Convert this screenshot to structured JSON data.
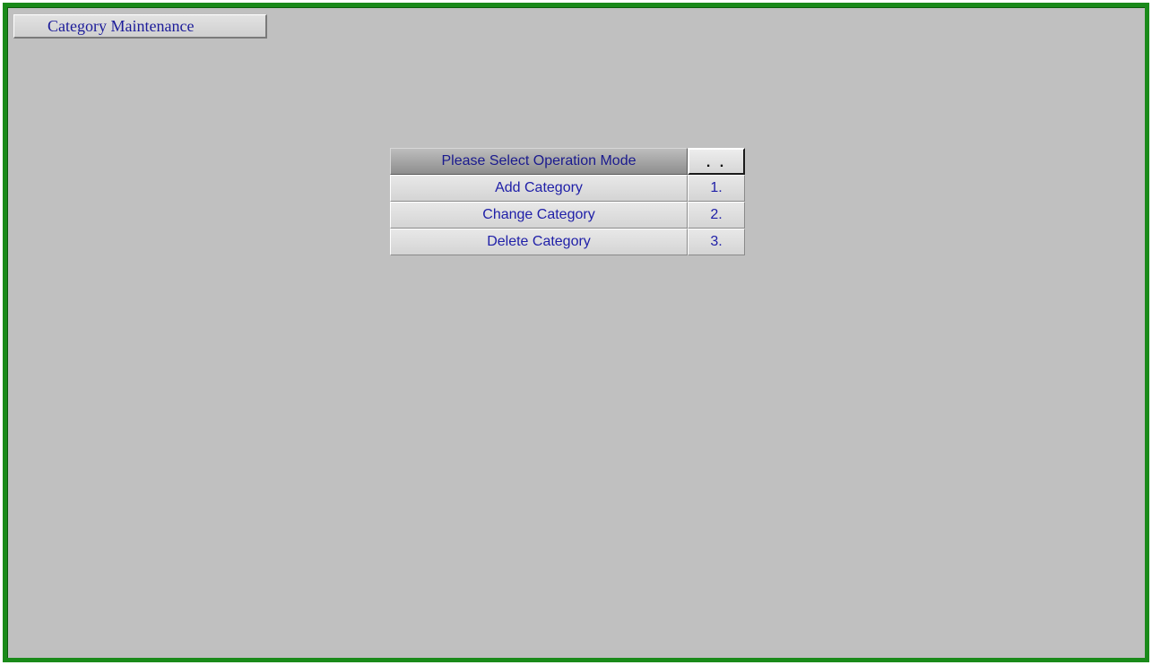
{
  "window": {
    "title": "Category Maintenance",
    "frame_color": "#1a8a1a",
    "background_color": "#c0c0c0"
  },
  "menu": {
    "header_label": "Please Select Operation Mode",
    "header_key": ". .",
    "text_color": "#2020a8",
    "items": [
      {
        "label": "Add Category",
        "key": "1."
      },
      {
        "label": "Change Category",
        "key": "2."
      },
      {
        "label": "Delete Category",
        "key": "3."
      }
    ]
  }
}
